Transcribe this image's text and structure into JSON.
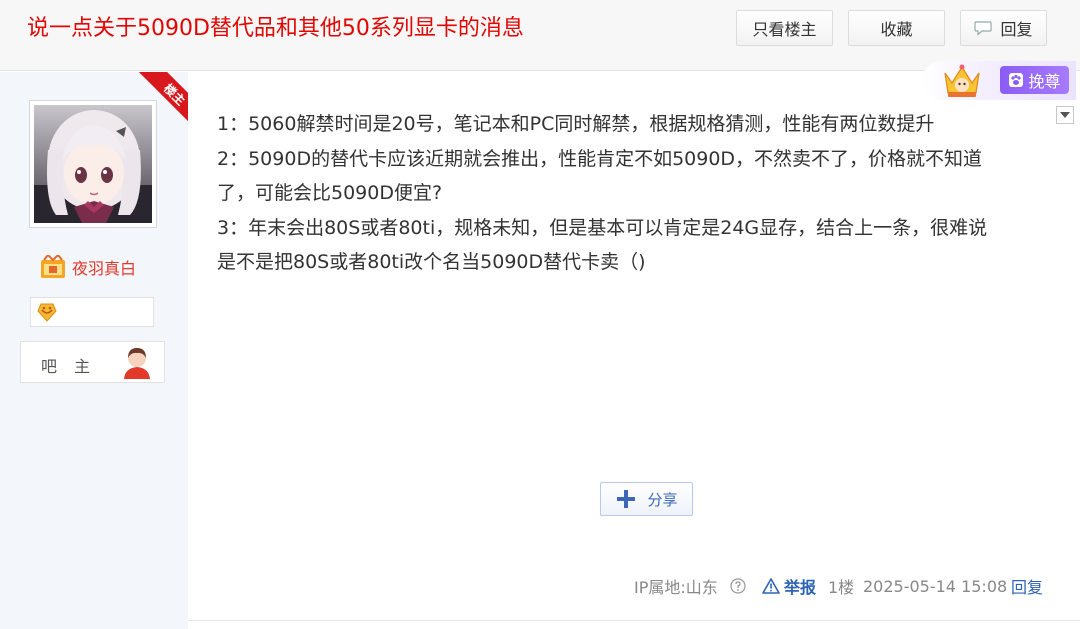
{
  "thread": {
    "title": "说一点关于5090D替代品和其他50系列显卡的消息"
  },
  "header": {
    "only_op_label": "只看楼主",
    "collect_label": "收藏",
    "reply_label": "回复"
  },
  "author": {
    "op_ribbon_label": "楼主",
    "username": "夜羽真白",
    "role_label": "吧 主"
  },
  "gift_badge": {
    "label": "挽尊"
  },
  "post": {
    "lines": [
      "1：5060解禁时间是20号，笔记本和PC同时解禁，根据规格猜测，性能有两位数提升",
      "2：5090D的替代卡应该近期就会推出，性能肯定不如5090D，不然卖不了，价格就不知道",
      "了，可能会比5090D便宜?",
      "3：年末会出80S或者80ti，规格未知，但是基本可以肯定是24G显存，结合上一条，很难说",
      "是不是把80S或者80ti改个名当5090D替代卡卖（)"
    ],
    "share_label": "分享"
  },
  "meta": {
    "ip_location": "IP属地:山东",
    "report_label": "举报",
    "floor": "1楼",
    "time": "2025-05-14 15:08",
    "reply_label": "回复"
  },
  "colors": {
    "title": "#e10602",
    "link": "#2d64b3",
    "ribbon": "#d8181c",
    "vip": "#8a5cf5",
    "sidebar_bg": "#f3f6fb"
  },
  "icons": [
    "reply-icon",
    "crown-icon",
    "paw-icon",
    "dropdown-icon",
    "user-badge-icon",
    "level-icon",
    "role-person-icon",
    "share-plus-icon",
    "help-icon",
    "warning-icon"
  ]
}
